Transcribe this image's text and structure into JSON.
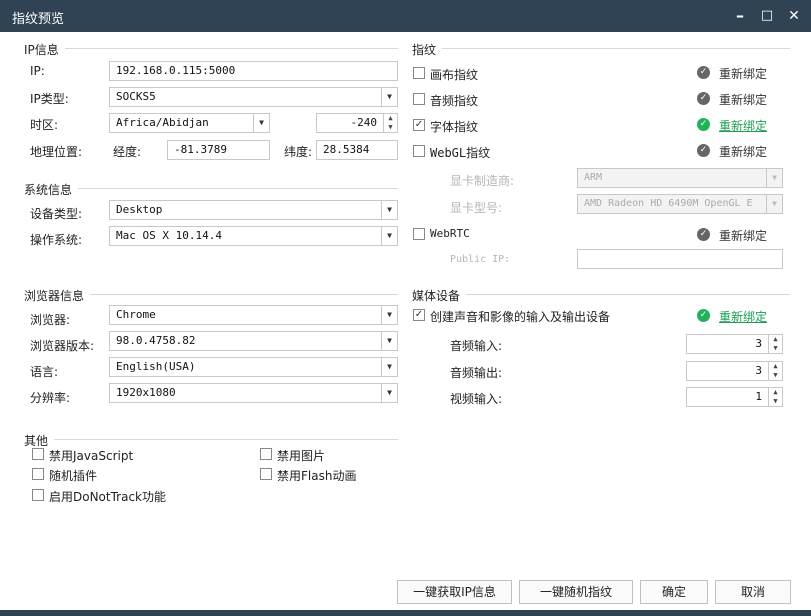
{
  "window": {
    "title": "指纹预览",
    "minimize": "–",
    "maximize": "□",
    "close": "✕"
  },
  "ip_info": {
    "section": "IP信息",
    "ip_label": "IP:",
    "ip_value": "192.168.0.115:5000",
    "ip_type_label": "IP类型:",
    "ip_type_value": "SOCKS5",
    "timezone_label": "时区:",
    "timezone_value": "Africa/Abidjan",
    "timezone_offset": "-240",
    "geo_label": "地理位置:",
    "lon_label": "经度:",
    "lon_value": "-81.3789",
    "lat_label": "纬度:",
    "lat_value": "28.5384"
  },
  "system_info": {
    "section": "系统信息",
    "device_type_label": "设备类型:",
    "device_type_value": "Desktop",
    "os_label": "操作系统:",
    "os_value": "Mac OS X 10.14.4"
  },
  "browser_info": {
    "section": "浏览器信息",
    "browser_label": "浏览器:",
    "browser_value": "Chrome",
    "version_label": "浏览器版本:",
    "version_value": "98.0.4758.82",
    "language_label": "语言:",
    "language_value": "English(USA)",
    "resolution_label": "分辨率:",
    "resolution_value": "1920x1080"
  },
  "other": {
    "section": "其他",
    "disable_js": "禁用JavaScript",
    "disable_images": "禁用图片",
    "random_plugins": "随机插件",
    "disable_flash": "禁用Flash动画",
    "dnt": "启用DoNotTrack功能"
  },
  "fingerprint": {
    "section": "指纹",
    "rebind": "重新绑定",
    "canvas": "画布指纹",
    "audio": "音频指纹",
    "font": "字体指纹",
    "webgl": "WebGL指纹",
    "gpu_vendor_label": "显卡制造商:",
    "gpu_vendor_value": "ARM",
    "gpu_model_label": "显卡型号:",
    "gpu_model_value": "AMD Radeon HD 6490M OpenGL E",
    "webrtc": "WebRTC",
    "public_ip_label": "Public IP:",
    "public_ip_value": ""
  },
  "media": {
    "section": "媒体设备",
    "create_devices": "创建声音和影像的输入及输出设备",
    "audio_in_label": "音频输入:",
    "audio_in_value": "3",
    "audio_out_label": "音频输出:",
    "audio_out_value": "3",
    "video_in_label": "视频输入:",
    "video_in_value": "1"
  },
  "buttons": {
    "get_ip": "一键获取IP信息",
    "random_fp": "一键随机指纹",
    "ok": "确定",
    "cancel": "取消"
  },
  "icons": {
    "dropdown": "▼",
    "spin_up": "▲",
    "spin_down": "▼",
    "check": "✓"
  },
  "colors": {
    "titlebar": "#2f4354",
    "accent_green": "#20b35a",
    "disabled_text": "#b5b5b5"
  }
}
